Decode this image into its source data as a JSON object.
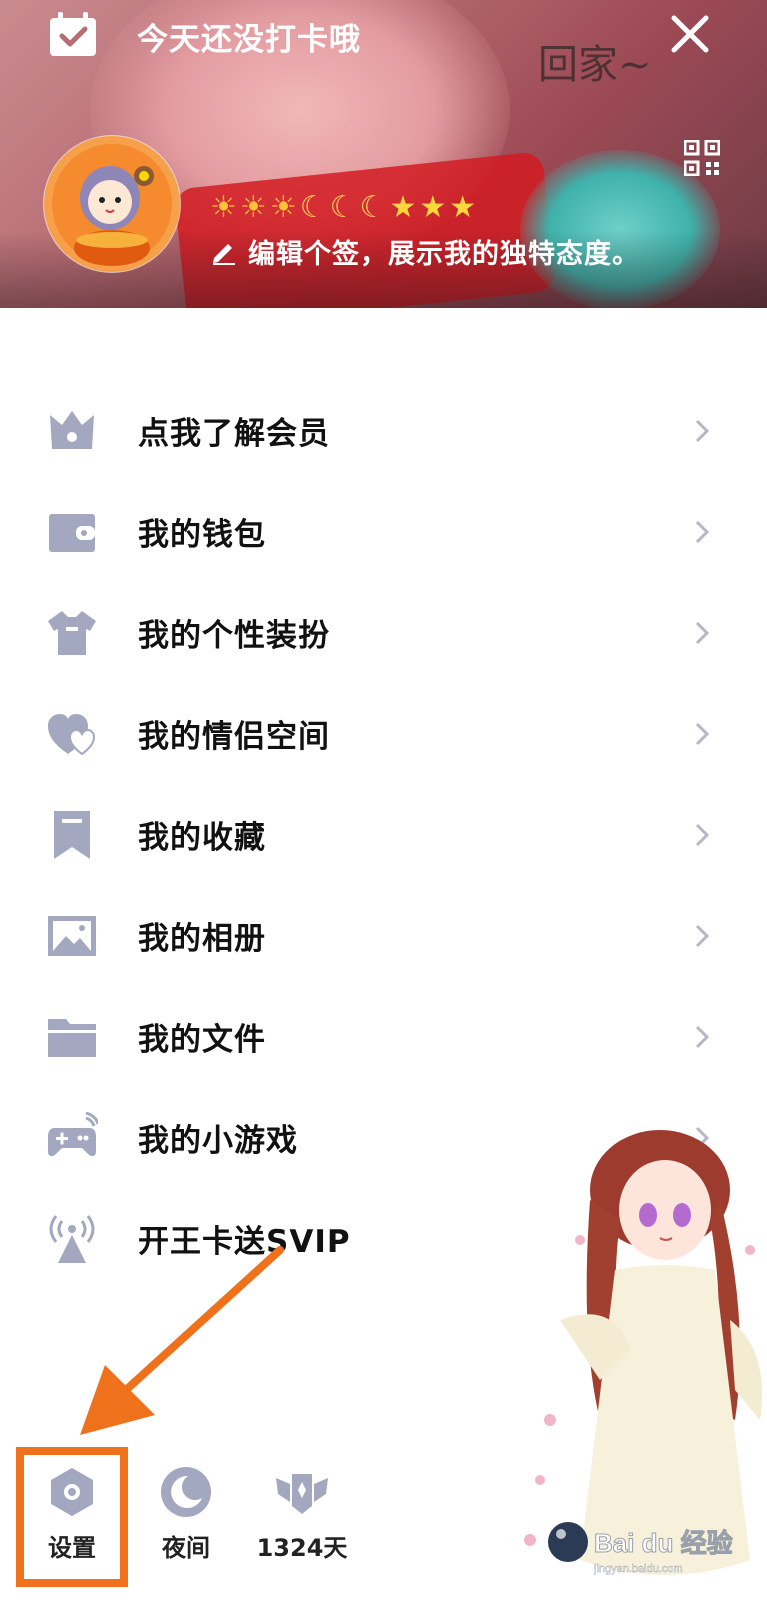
{
  "header": {
    "checkin_text": "今天还没打卡哦",
    "handwriting": "回家~",
    "signature": "编辑个签，展示我的独特态度。",
    "level_icons": [
      "sun",
      "sun",
      "sun",
      "moon",
      "moon",
      "moon",
      "star",
      "star",
      "star"
    ]
  },
  "menu": {
    "items": [
      {
        "label": "点我了解会员",
        "icon": "crown-icon",
        "chevron": true
      },
      {
        "label": "我的钱包",
        "icon": "wallet-icon",
        "chevron": true
      },
      {
        "label": "我的个性装扮",
        "icon": "shirt-icon",
        "chevron": true
      },
      {
        "label": "我的情侣空间",
        "icon": "hearts-icon",
        "chevron": true
      },
      {
        "label": "我的收藏",
        "icon": "bookmark-icon",
        "chevron": true
      },
      {
        "label": "我的相册",
        "icon": "image-icon",
        "chevron": true
      },
      {
        "label": "我的文件",
        "icon": "folder-icon",
        "chevron": true
      },
      {
        "label": "我的小游戏",
        "icon": "gamepad-icon",
        "chevron": true
      },
      {
        "label": "开王卡送SVIP",
        "icon": "signal-tower-icon",
        "chevron": false
      }
    ]
  },
  "bottom": {
    "settings_label": "设置",
    "night_label": "夜间",
    "days_label": "1324天"
  },
  "colors": {
    "icon": "#a3a8c0",
    "highlight": "#f0711c",
    "text": "#111111"
  },
  "watermark": {
    "text": "Bai du 经验",
    "subtext": "jingyan.baidu.com"
  }
}
